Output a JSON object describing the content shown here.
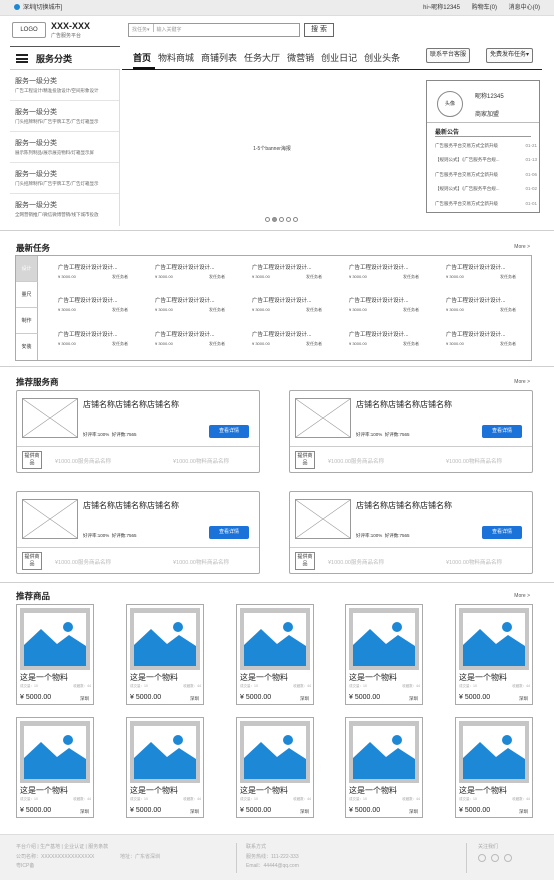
{
  "topbar": {
    "location": "深圳[切换城市]",
    "user": "hi~昵称12345",
    "cart": "购物车(0)",
    "messages": "消息中心(0)"
  },
  "header": {
    "logo": "LOGO",
    "brand_name": "XXX-XXX",
    "brand_sub": "广告服务平台",
    "search_type": "找任务",
    "search_placeholder": "输入关键字",
    "search_button": "搜 索",
    "service_btn": "联系平台客服",
    "publish_btn": "免费发布任务▾"
  },
  "nav": {
    "category_title": "服务分类",
    "items": [
      "首页",
      "物料商城",
      "商铺列表",
      "任务大厅",
      "微营销",
      "创业日记",
      "创业头条"
    ]
  },
  "sidebar": [
    {
      "title": "服务一级分类",
      "sub": "广告工程设计/精准投放设计/空间形象设计"
    },
    {
      "title": "服务一级分类",
      "sub": "门头招牌制作/广告字牌工艺/广告灯箱显示"
    },
    {
      "title": "服务一级分类",
      "sub": "展示陈列制品/展示展览物料/灯箱显示屏"
    },
    {
      "title": "服务一级分类",
      "sub": "门头招牌制作/广告字牌工艺/广告灯箱显示"
    },
    {
      "title": "服务一级分类",
      "sub": "全网营销推广/微信微博营销/线下城市投放"
    }
  ],
  "banner": {
    "text": "1-5个banner海报"
  },
  "user_box": {
    "avatar": "头像",
    "nickname": "昵称12345",
    "join": "商家加盟",
    "notice_title": "最新公告",
    "notices": [
      {
        "text": "广告服务平台交易方式全新升级",
        "date": "01-21"
      },
      {
        "text": "【规则公式】《广告服务平台规...",
        "date": "01-13"
      },
      {
        "text": "广告服务平台交易方式全新升级",
        "date": "01-06"
      },
      {
        "text": "【规则公式】《广告服务平台规...",
        "date": "01-02"
      },
      {
        "text": "广告服务平台交易方式全新升级",
        "date": "01-01"
      }
    ]
  },
  "tasks": {
    "title": "最新任务",
    "more": "More >",
    "tabs": [
      "设计",
      "量尺",
      "制作",
      "安装"
    ],
    "item": {
      "title": "广告工程设计设计设计...",
      "price": "¥ 3000.00",
      "publisher": "发任务者"
    }
  },
  "shops": {
    "title": "推荐服务商",
    "more": "More >",
    "item": {
      "name": "店铺名称店铺名称店铺名称",
      "rating": "好评率:100%",
      "rating2": "好评数:7565",
      "detail": "查看详情",
      "provide": "提供商品",
      "p1": "¥1000.00服务商品名称",
      "p2": "¥1000.00物料商品名称"
    }
  },
  "goods": {
    "title": "推荐商品",
    "more": "More >",
    "item": {
      "name": "这是一个物料",
      "sales": "成交量：10",
      "fav": "收藏数：44",
      "price": "¥ 5000.00",
      "location": "深圳"
    }
  },
  "footer": {
    "links": "平台介绍  |  生产基地  |  企业认证  |  服务条款",
    "company": "公司名称：XXXXXXXXXXXXXXXX",
    "address": "地址：广东省深圳",
    "icp": "粤ICP备",
    "contact_title": "联系方式",
    "phone": "服务热线：111-222-333",
    "email": "Email：44444@qq.com",
    "follow": "关注我们"
  },
  "colors": {
    "accent": "#1b72d8",
    "image_blue": "#1d88d6"
  }
}
